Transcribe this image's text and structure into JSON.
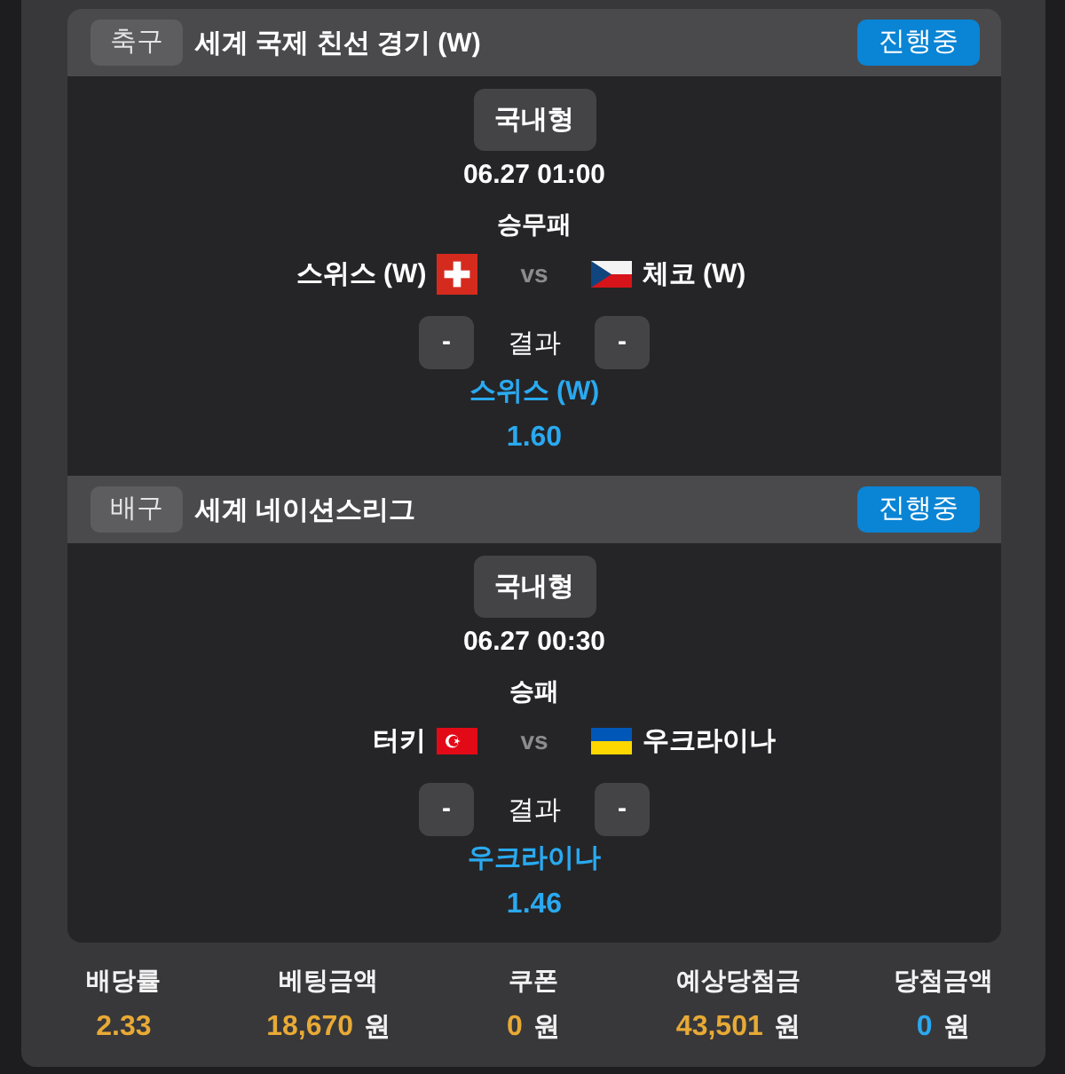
{
  "matches": [
    {
      "sport": "축구",
      "league": "세계 국제 친선 경기 (W)",
      "status": "진행중",
      "bet_type": "국내형",
      "time": "06.27 01:00",
      "market": "승무패",
      "teams": [
        {
          "name": "스위스 (W)",
          "kind": "swiss"
        },
        {
          "name": "체코 (W)",
          "kind": "czech"
        }
      ],
      "versus": "vs",
      "home_score": "-",
      "result_label": "결과",
      "away_score": "-",
      "pick": "스위스 (W)",
      "odds": "1.60"
    },
    {
      "sport": "배구",
      "league": "세계 네이션스리그",
      "status": "진행중",
      "bet_type": "국내형",
      "time": "06.27 00:30",
      "market": "승패",
      "teams": [
        {
          "name": "터키",
          "kind": "turkish"
        },
        {
          "name": "우크라이나",
          "kind": "ukrainian"
        }
      ],
      "versus": "vs",
      "home_score": "-",
      "result_label": "결과",
      "away_score": "-",
      "pick": "우크라이나",
      "odds": "1.46"
    }
  ],
  "summary": [
    {
      "label": "배당률",
      "value": "2.33",
      "color": "#e8aa35"
    },
    {
      "label": "베팅금액",
      "value": "18,670",
      "unit": "원",
      "color": "#e8aa35"
    },
    {
      "label": "쿠폰",
      "value": "0",
      "unit": "원",
      "color": "#e8aa35"
    },
    {
      "label": "예상당첨금",
      "value": "43,501",
      "unit": "원",
      "color": "#e8aa35"
    },
    {
      "label": "당첨금액",
      "value": "0",
      "unit": "원",
      "color": "#2aa9f0"
    }
  ]
}
